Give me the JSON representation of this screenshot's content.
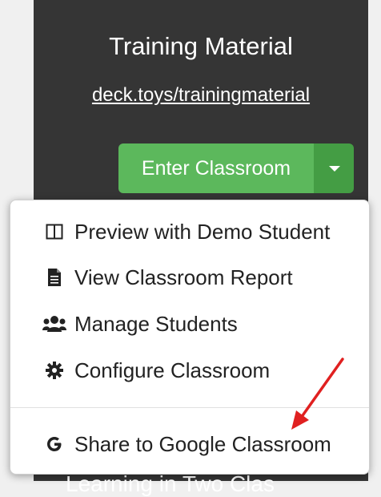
{
  "card": {
    "title": "Training Material",
    "link": "deck.toys/trainingmaterial",
    "enter_button": "Enter Classroom",
    "bottom_text_partial": "Learning in Two Clas"
  },
  "menu": {
    "items": [
      {
        "label": "Preview with Demo Student",
        "icon": "columns-icon"
      },
      {
        "label": "View Classroom Report",
        "icon": "document-icon"
      },
      {
        "label": "Manage Students",
        "icon": "users-icon"
      },
      {
        "label": "Configure Classroom",
        "icon": "gear-icon"
      },
      {
        "label": "Share to Google Classroom",
        "icon": "google-icon"
      }
    ]
  },
  "colors": {
    "card_bg": "#353535",
    "button_green": "#5cb85c",
    "button_green_dark": "#449d44",
    "annotation_arrow": "#e02020"
  }
}
